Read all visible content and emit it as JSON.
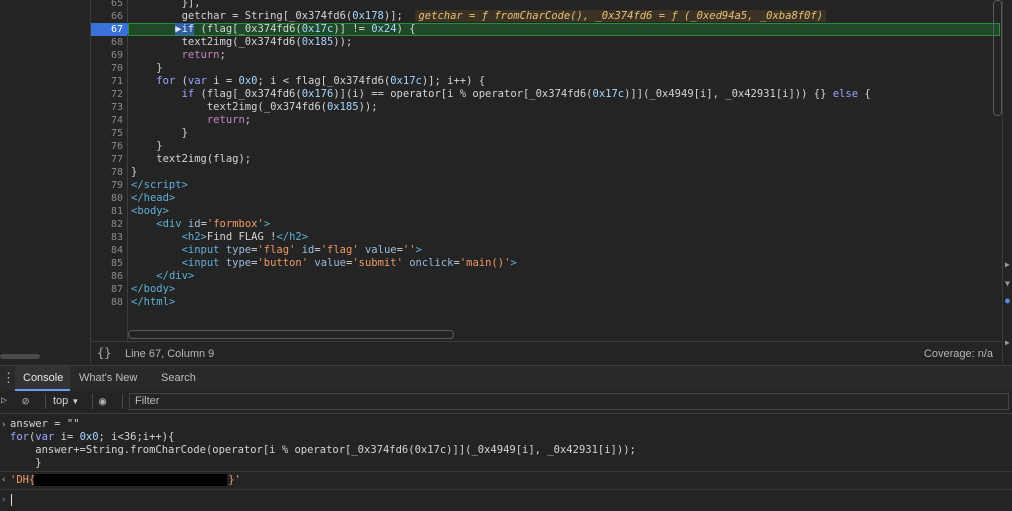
{
  "editor": {
    "line_numbers": [
      "65",
      "66",
      "67",
      "68",
      "69",
      "70",
      "71",
      "72",
      "73",
      "74",
      "75",
      "76",
      "77",
      "78",
      "79",
      "80",
      "81",
      "82",
      "83",
      "84",
      "85",
      "86",
      "87",
      "88"
    ],
    "active_line": "67",
    "inline_value": "getchar = ƒ fromCharCode(), _0x374fd6 = ƒ (_0xed94a5, _0xba8f0f)"
  },
  "status_bar": {
    "braces": "{}",
    "position": "Line 67, Column 9",
    "coverage": "Coverage: n/a"
  },
  "drawer": {
    "tabs": [
      "Console",
      "What's New",
      "Search"
    ],
    "active_tab": "Console"
  },
  "console_toolbar": {
    "context": "top",
    "filter_placeholder": "Filter"
  },
  "console": {
    "input_lines": [
      "answer = \"\"",
      "for(var i= 0x0; i<36;i++){",
      "    answer+=String.fromCharCode(operator[i % operator[_0x374fd6(0x17c)]](_0x4949[i], _0x42931[i]));",
      "    }"
    ],
    "result_prefix": "'DH{",
    "result_suffix": "}'"
  },
  "colors": {
    "background": "#242424",
    "breakpoint": "#3871d8",
    "highlight_line": "#1f4a2a",
    "string": "#f29766"
  }
}
